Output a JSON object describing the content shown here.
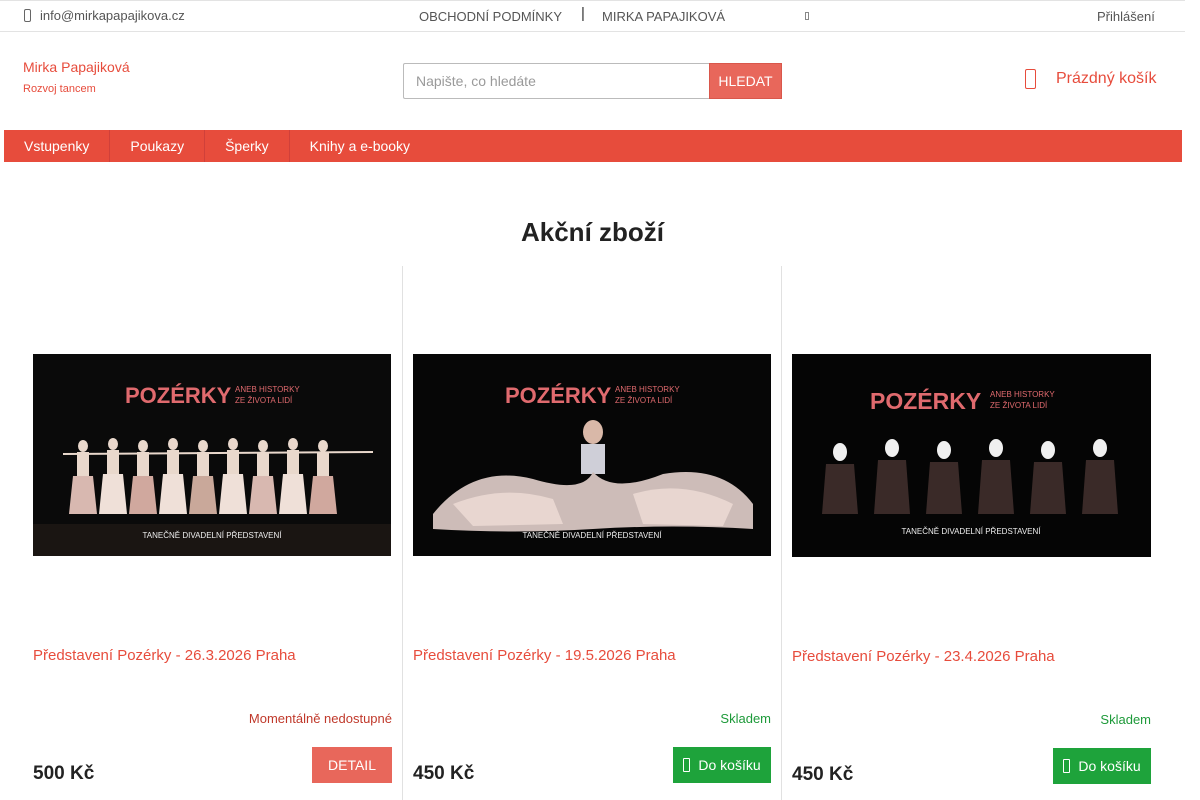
{
  "topbar": {
    "email": "info@mirkapapajikova.cz",
    "links": [
      "OBCHODNÍ PODMÍNKY",
      "MIRKA PAPAJIKOVÁ"
    ],
    "separator": "|",
    "login": "Přihlášení"
  },
  "header": {
    "brand_name": "Mirka Papajiková",
    "brand_tagline": "Rozvoj tancem",
    "search": {
      "placeholder": "Napište, co hledáte",
      "button_label": "HLEDAT"
    },
    "cart_label": "Prázdný košík"
  },
  "categories": [
    "Vstupenky",
    "Poukazy",
    "Šperky",
    "Knihy a e-booky"
  ],
  "section_title": "Akční zboží",
  "products": [
    {
      "name": "Představení Pozérky - 26.3.2026 Praha",
      "stock": "Momentálně nedostupné",
      "price": "500 Kč",
      "button": "DETAIL",
      "poster": {
        "title": "POZÉRKY",
        "subtitle_1": "ANEB HISTORKY",
        "subtitle_2": "ZE ŽIVOTA LIDÍ",
        "footer": "TANEČNĚ DIVADELNÍ PŘEDSTAVENÍ"
      }
    },
    {
      "name": "Představení Pozérky - 19.5.2026 Praha",
      "stock": "Skladem",
      "price": "450 Kč",
      "button": "Do košíku",
      "poster": {
        "title": "POZÉRKY",
        "subtitle_1": "ANEB HISTORKY",
        "subtitle_2": "ZE ŽIVOTA LIDÍ",
        "footer": "TANEČNĚ DIVADELNÍ PŘEDSTAVENÍ"
      }
    },
    {
      "name": "Představení Pozérky - 23.4.2026 Praha",
      "stock": "Skladem",
      "price": "450 Kč",
      "button": "Do košíku",
      "poster": {
        "title": "POZÉRKY",
        "subtitle_1": "ANEB HISTORKY",
        "subtitle_2": "ZE ŽIVOTA LIDÍ",
        "footer": "TANEČNĚ DIVADELNÍ PŘEDSTAVENÍ"
      }
    }
  ],
  "icons": {
    "phone": "phone-icon",
    "cart": "shopping-bag-icon",
    "button_cart": "shopping-bag-icon"
  },
  "colors": {
    "accent": "#e74c3c",
    "success": "#1ea33b",
    "unavailable": "#c0392b"
  }
}
